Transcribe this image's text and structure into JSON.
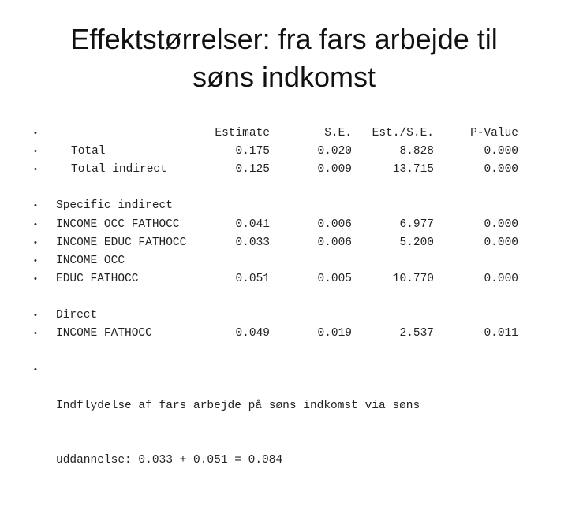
{
  "title": {
    "line1": "Effektstørrelser: fra fars arbejde til",
    "line2": "søns indkomst"
  },
  "table": {
    "headers": [
      "Estimate",
      "S.E.",
      "Est./S.E.",
      "P-Value"
    ],
    "rows": [
      {
        "label": "Total",
        "values": [
          "0.175",
          "0.020",
          "8.828",
          "0.000"
        ]
      },
      {
        "label": "Total indirect",
        "values": [
          "0.125",
          "0.009",
          "13.715",
          "0.000"
        ]
      },
      {
        "label": "Specific indirect",
        "values": []
      },
      {
        "label": "INCOME OCC FATHOCC",
        "values": [
          "0.041",
          "0.006",
          "6.977",
          "0.000"
        ]
      },
      {
        "label": "INCOME EDUC FATHOCC",
        "values": [
          "0.033",
          "0.006",
          "5.200",
          "0.000"
        ]
      },
      {
        "label": "INCOME OCC",
        "values": []
      },
      {
        "label": "EDUC FATHOCC",
        "values": [
          "0.051",
          "0.005",
          "10.770",
          "0.000"
        ]
      },
      {
        "label": "Direct",
        "values": []
      },
      {
        "label": "INCOME FATHOCC",
        "values": [
          "0.049",
          "0.019",
          "2.537",
          "0.011"
        ]
      }
    ]
  },
  "note": {
    "line1": "Indflydelse af fars arbejde på søns indkomst via søns",
    "line2": "uddannelse: 0.033 + 0.051 = 0.084"
  },
  "bullet_glyph": "•"
}
